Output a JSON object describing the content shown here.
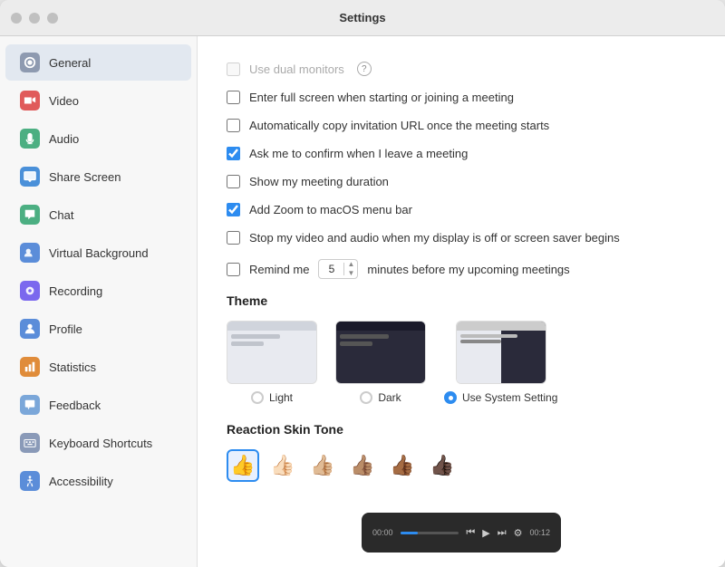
{
  "window": {
    "title": "Settings"
  },
  "sidebar": {
    "items": [
      {
        "id": "general",
        "label": "General",
        "icon_type": "general",
        "active": true
      },
      {
        "id": "video",
        "label": "Video",
        "icon_type": "video",
        "active": false
      },
      {
        "id": "audio",
        "label": "Audio",
        "icon_type": "audio",
        "active": false
      },
      {
        "id": "sharescreen",
        "label": "Share Screen",
        "icon_type": "sharescreen",
        "active": false
      },
      {
        "id": "chat",
        "label": "Chat",
        "icon_type": "chat",
        "active": false
      },
      {
        "id": "virtualbackground",
        "label": "Virtual Background",
        "icon_type": "vbg",
        "active": false
      },
      {
        "id": "recording",
        "label": "Recording",
        "icon_type": "recording",
        "active": false
      },
      {
        "id": "profile",
        "label": "Profile",
        "icon_type": "profile",
        "active": false
      },
      {
        "id": "statistics",
        "label": "Statistics",
        "icon_type": "statistics",
        "active": false
      },
      {
        "id": "feedback",
        "label": "Feedback",
        "icon_type": "feedback",
        "active": false
      },
      {
        "id": "keyboard",
        "label": "Keyboard Shortcuts",
        "icon_type": "keyboard",
        "active": false
      },
      {
        "id": "accessibility",
        "label": "Accessibility",
        "icon_type": "accessibility",
        "active": false
      }
    ]
  },
  "main": {
    "checkboxes": [
      {
        "id": "dual_monitors",
        "label": "Use dual monitors",
        "checked": false,
        "disabled": true,
        "help": true
      },
      {
        "id": "fullscreen",
        "label": "Enter full screen when starting or joining a meeting",
        "checked": false,
        "disabled": false
      },
      {
        "id": "copy_url",
        "label": "Automatically copy invitation URL once the meeting starts",
        "checked": false,
        "disabled": false
      },
      {
        "id": "confirm_leave",
        "label": "Ask me to confirm when I leave a meeting",
        "checked": true,
        "disabled": false
      },
      {
        "id": "show_duration",
        "label": "Show my meeting duration",
        "checked": false,
        "disabled": false
      },
      {
        "id": "add_zoom_menu",
        "label": "Add Zoom to macOS menu bar",
        "checked": true,
        "disabled": false
      },
      {
        "id": "stop_video",
        "label": "Stop my video and audio when my display is off or screen saver begins",
        "checked": false,
        "disabled": false
      }
    ],
    "reminder": {
      "label_before": "Remind me",
      "value": "5",
      "label_after": "minutes before my upcoming meetings"
    },
    "theme": {
      "title": "Theme",
      "options": [
        {
          "id": "light",
          "label": "Light",
          "selected": false
        },
        {
          "id": "dark",
          "label": "Dark",
          "selected": false
        },
        {
          "id": "system",
          "label": "Use System Setting",
          "selected": true
        }
      ]
    },
    "skin_tone": {
      "title": "Reaction Skin Tone",
      "tones": [
        "👍",
        "👍🏻",
        "👍🏼",
        "👍🏽",
        "👍🏾",
        "👍🏿"
      ],
      "selected_index": 0
    }
  }
}
